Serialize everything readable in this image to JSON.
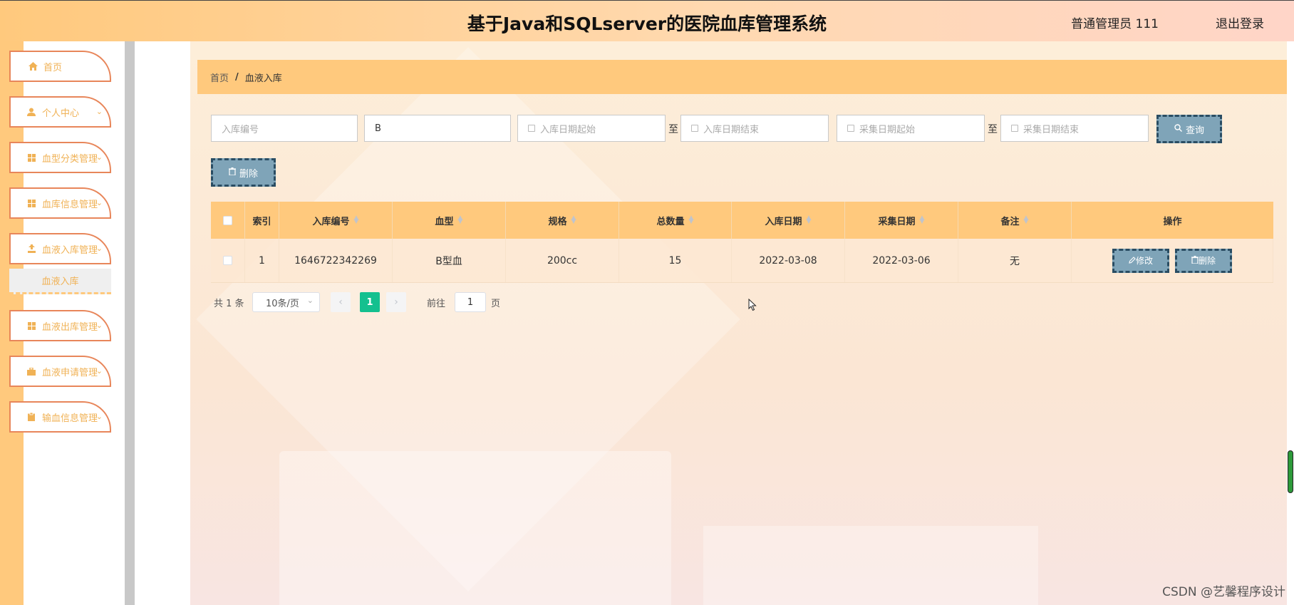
{
  "header": {
    "title": "基于Java和SQLserver的医院血库管理系统",
    "user": "普通管理员 111",
    "logout": "退出登录"
  },
  "sidebar": {
    "items": [
      {
        "label": "首页",
        "icon": "home-icon"
      },
      {
        "label": "个人中心",
        "icon": "user-icon"
      },
      {
        "label": "血型分类管理",
        "icon": "grid-icon"
      },
      {
        "label": "血库信息管理",
        "icon": "grid-icon"
      },
      {
        "label": "血液入库管理",
        "icon": "upload-icon"
      },
      {
        "label": "血液出库管理",
        "icon": "grid-icon"
      },
      {
        "label": "血液申请管理",
        "icon": "briefcase-icon"
      },
      {
        "label": "输血信息管理",
        "icon": "clipboard-icon"
      }
    ],
    "submenu_active": "血液入库"
  },
  "breadcrumb": {
    "home": "首页",
    "separator": "/",
    "current": "血液入库"
  },
  "search": {
    "inbound_no_placeholder": "入库编号",
    "blood_type_value": "B",
    "inbound_date_start": "入库日期起始",
    "range_to": "至",
    "inbound_date_end": "入库日期结束",
    "collect_date_start": "采集日期起始",
    "collect_date_end": "采集日期结束",
    "query_label": "查询",
    "delete_label": "删除"
  },
  "table": {
    "headers": [
      "索引",
      "入库编号",
      "血型",
      "规格",
      "总数量",
      "入库日期",
      "采集日期",
      "备注",
      "操作"
    ],
    "rows": [
      {
        "index": "1",
        "inbound_no": "1646722342269",
        "blood_type": "B型血",
        "spec": "200cc",
        "quantity": "15",
        "inbound_date": "2022-03-08",
        "collect_date": "2022-03-06",
        "remark": "无",
        "edit_label": "修改",
        "delete_label": "删除"
      }
    ]
  },
  "pagination": {
    "total": "共 1 条",
    "page_size": "10条/页",
    "current_page": "1",
    "goto_label": "前往",
    "goto_value": "1",
    "page_unit": "页"
  },
  "watermark": "CSDN @艺馨程序设计",
  "colors": {
    "accent": "#ffc97d",
    "menu_border": "#e8865a",
    "button": "#7fa4b8",
    "button_border": "#2a4d63",
    "page_active": "#14c08f"
  }
}
